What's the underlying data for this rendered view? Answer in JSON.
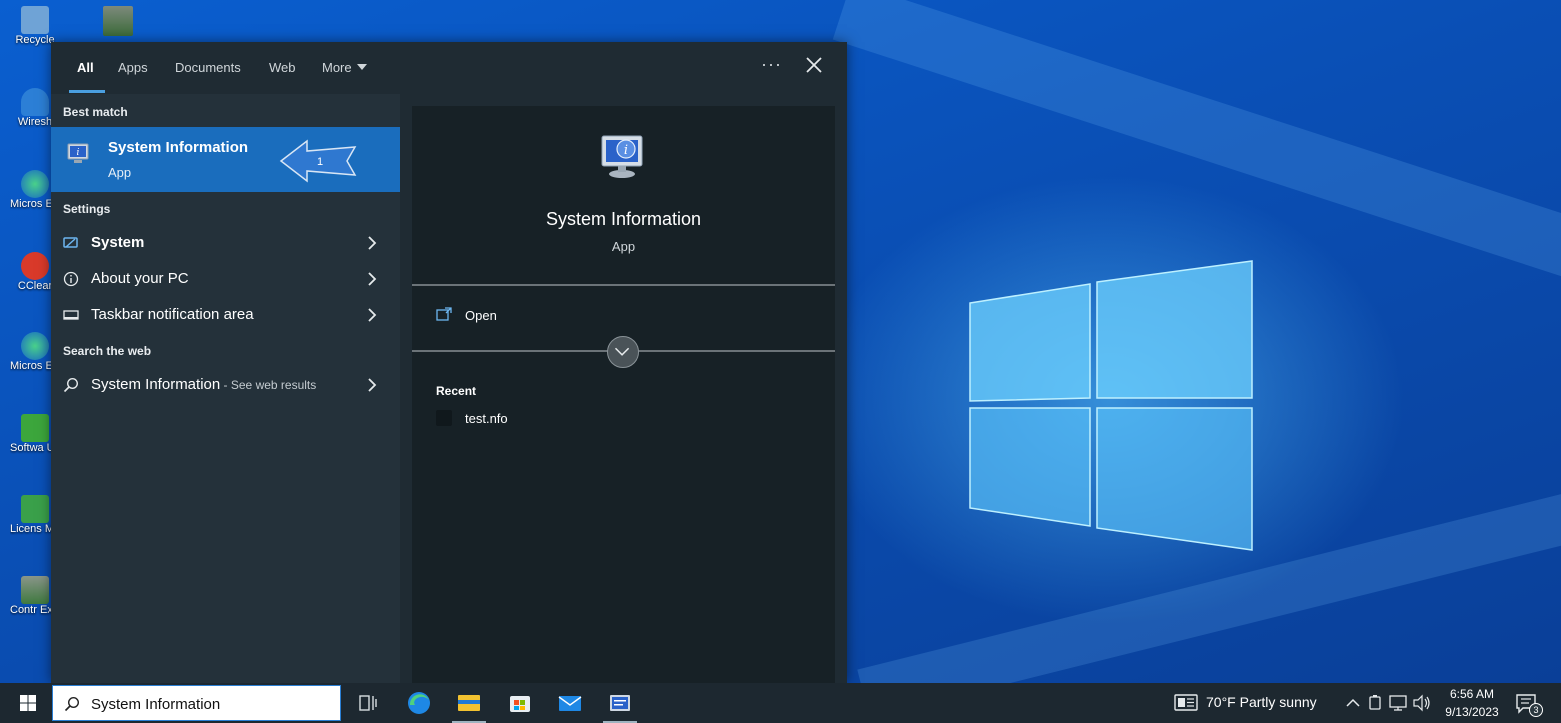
{
  "desktop": {
    "icons": [
      {
        "label": "Recycle",
        "icon": "recycle-bin-icon"
      },
      {
        "label": "Wiresh",
        "icon": "wireshark-icon"
      },
      {
        "label": "Micros Edge",
        "icon": "edge-icon"
      },
      {
        "label": "CClear",
        "icon": "ccleaner-icon"
      },
      {
        "label": "Micros Edge",
        "icon": "edge-icon"
      },
      {
        "label": "Softwa Upda",
        "icon": "software-updater-icon"
      },
      {
        "label": "Licens Manac",
        "icon": "license-manager-icon"
      },
      {
        "label": "Contr Exper",
        "icon": "control-expert-icon"
      }
    ]
  },
  "search_panel": {
    "tabs": [
      {
        "label": "All",
        "active": true
      },
      {
        "label": "Apps",
        "active": false
      },
      {
        "label": "Documents",
        "active": false
      },
      {
        "label": "Web",
        "active": false
      },
      {
        "label": "More",
        "active": false
      }
    ],
    "options_label": "···",
    "best_match": {
      "heading": "Best match",
      "title": "System Information",
      "subtitle": "App",
      "annotation_number": "1"
    },
    "settings": {
      "heading": "Settings",
      "items": [
        {
          "label": "System",
          "icon": "display-settings-icon",
          "bold": true
        },
        {
          "label": "About your PC",
          "icon": "info-icon",
          "bold": false
        },
        {
          "label": "Taskbar notification area",
          "icon": "taskbar-icon",
          "bold": false
        }
      ]
    },
    "web": {
      "heading": "Search the web",
      "query": "System Information",
      "suffix": " - See web results"
    },
    "detail": {
      "app_name": "System Information",
      "app_type": "App",
      "open_label": "Open",
      "recent_heading": "Recent",
      "recent_items": [
        "test.nfo"
      ]
    }
  },
  "taskbar": {
    "search_value": "System Information",
    "apps": [
      "task-view-icon",
      "edge-icon",
      "file-explorer-icon",
      "store-icon",
      "mail-icon",
      "system-information-icon"
    ],
    "weather": "70°F  Partly sunny",
    "time": "6:56 AM",
    "date": "9/13/2023",
    "notification_count": "3"
  },
  "colors": {
    "accent": "#1a6dbd",
    "panel_bg": "#1f2b33",
    "detail_bg": "#172126",
    "taskbar_bg": "#1d2830"
  }
}
